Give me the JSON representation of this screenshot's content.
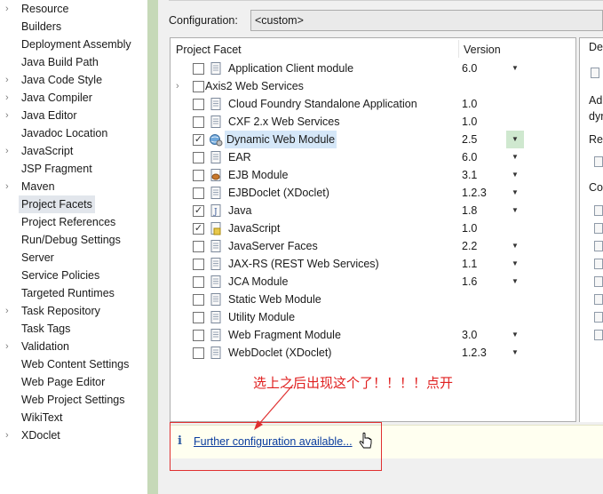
{
  "sidebar": {
    "items": [
      {
        "label": "Resource",
        "expandable": true
      },
      {
        "label": "Builders",
        "expandable": false
      },
      {
        "label": "Deployment Assembly",
        "expandable": false
      },
      {
        "label": "Java Build Path",
        "expandable": false
      },
      {
        "label": "Java Code Style",
        "expandable": true
      },
      {
        "label": "Java Compiler",
        "expandable": true
      },
      {
        "label": "Java Editor",
        "expandable": true
      },
      {
        "label": "Javadoc Location",
        "expandable": false
      },
      {
        "label": "JavaScript",
        "expandable": true
      },
      {
        "label": "JSP Fragment",
        "expandable": false
      },
      {
        "label": "Maven",
        "expandable": true
      },
      {
        "label": "Project Facets",
        "expandable": false,
        "selected": true
      },
      {
        "label": "Project References",
        "expandable": false
      },
      {
        "label": "Run/Debug Settings",
        "expandable": false
      },
      {
        "label": "Server",
        "expandable": false
      },
      {
        "label": "Service Policies",
        "expandable": false
      },
      {
        "label": "Targeted Runtimes",
        "expandable": false
      },
      {
        "label": "Task Repository",
        "expandable": true
      },
      {
        "label": "Task Tags",
        "expandable": false
      },
      {
        "label": "Validation",
        "expandable": true
      },
      {
        "label": "Web Content Settings",
        "expandable": false
      },
      {
        "label": "Web Page Editor",
        "expandable": false
      },
      {
        "label": "Web Project Settings",
        "expandable": false
      },
      {
        "label": "WikiText",
        "expandable": false
      },
      {
        "label": "XDoclet",
        "expandable": true
      }
    ]
  },
  "configuration": {
    "label": "Configuration:",
    "value": "<custom>"
  },
  "facets_table": {
    "header_facet": "Project Facet",
    "header_version": "Version",
    "rows": [
      {
        "name": "Application Client module",
        "checked": false,
        "version": "6.0",
        "dropdown": true,
        "icon": "document-icon"
      },
      {
        "name": "Axis2 Web Services",
        "checked": false,
        "version": "",
        "dropdown": false,
        "icon": "",
        "expander": true
      },
      {
        "name": "Cloud Foundry Standalone Application",
        "checked": false,
        "version": "1.0",
        "dropdown": false,
        "icon": "document-icon"
      },
      {
        "name": "CXF 2.x Web Services",
        "checked": false,
        "version": "1.0",
        "dropdown": false,
        "icon": "document-icon"
      },
      {
        "name": "Dynamic Web Module",
        "checked": true,
        "version": "2.5",
        "dropdown": true,
        "icon": "globe-gear-icon",
        "highlight": true,
        "dropdown_green": true
      },
      {
        "name": "EAR",
        "checked": false,
        "version": "6.0",
        "dropdown": true,
        "icon": "document-icon"
      },
      {
        "name": "EJB Module",
        "checked": false,
        "version": "3.1",
        "dropdown": true,
        "icon": "bean-icon"
      },
      {
        "name": "EJBDoclet (XDoclet)",
        "checked": false,
        "version": "1.2.3",
        "dropdown": true,
        "icon": "document-icon"
      },
      {
        "name": "Java",
        "checked": true,
        "version": "1.8",
        "dropdown": true,
        "icon": "java-icon"
      },
      {
        "name": "JavaScript",
        "checked": true,
        "version": "1.0",
        "dropdown": false,
        "icon": "javascript-icon"
      },
      {
        "name": "JavaServer Faces",
        "checked": false,
        "version": "2.2",
        "dropdown": true,
        "icon": "document-icon"
      },
      {
        "name": "JAX-RS (REST Web Services)",
        "checked": false,
        "version": "1.1",
        "dropdown": true,
        "icon": "document-icon"
      },
      {
        "name": "JCA Module",
        "checked": false,
        "version": "1.6",
        "dropdown": true,
        "icon": "document-icon"
      },
      {
        "name": "Static Web Module",
        "checked": false,
        "version": "",
        "dropdown": false,
        "icon": "document-icon"
      },
      {
        "name": "Utility Module",
        "checked": false,
        "version": "",
        "dropdown": false,
        "icon": "document-icon"
      },
      {
        "name": "Web Fragment Module",
        "checked": false,
        "version": "3.0",
        "dropdown": true,
        "icon": "document-icon"
      },
      {
        "name": "WebDoclet (XDoclet)",
        "checked": false,
        "version": "1.2.3",
        "dropdown": true,
        "icon": "document-icon"
      }
    ]
  },
  "right_panel": {
    "texts": [
      "De",
      "Ad",
      "dyr",
      "Re",
      "Co"
    ]
  },
  "info_bar": {
    "icon": "info-icon",
    "link_text": "Further configuration available..."
  },
  "annotation": {
    "text": "选上之后出现这个了！！！！点开",
    "color": "#e02020"
  },
  "colors": {
    "accent_green": "#c6d9b8",
    "selection": "#d5e7f8",
    "link": "#0a3c9e",
    "annotation_red": "#e03030"
  }
}
